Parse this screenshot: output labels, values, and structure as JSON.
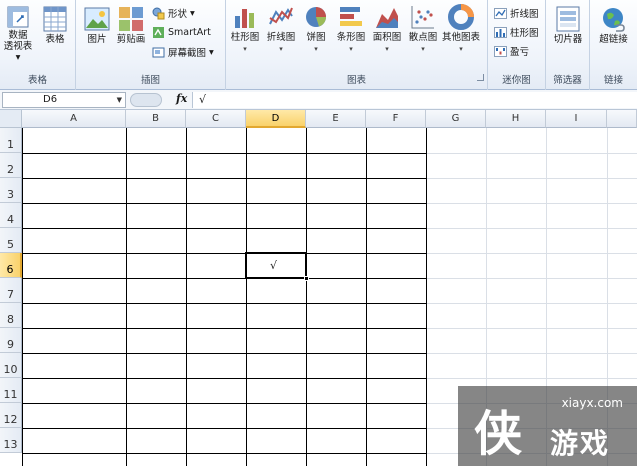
{
  "ribbon": {
    "tables_group": {
      "label": "表格",
      "pivot_line1": "数据",
      "pivot_line2": "透视表",
      "table": "表格"
    },
    "illustrations_group": {
      "label": "插图",
      "picture": "图片",
      "clipart": "剪贴画",
      "shapes": "形状",
      "smartart": "SmartArt",
      "screenshot": "屏幕截图"
    },
    "charts_group": {
      "label": "图表",
      "column": "柱形图",
      "line": "折线图",
      "pie": "饼图",
      "bar": "条形图",
      "area": "面积图",
      "scatter": "散点图",
      "other": "其他图表"
    },
    "sparklines_group": {
      "label": "迷你图",
      "line": "折线图",
      "column": "柱形图",
      "winloss": "盈亏"
    },
    "filter_group": {
      "label": "筛选器",
      "slicer": "切片器"
    },
    "links_group": {
      "label": "链接",
      "hyperlink": "超链接"
    }
  },
  "formula_bar": {
    "name_box": "D6",
    "fx_label": "fx",
    "content": "√"
  },
  "sheet": {
    "columns": [
      "A",
      "B",
      "C",
      "D",
      "E",
      "F",
      "G",
      "H",
      "I"
    ],
    "rows": [
      "1",
      "2",
      "3",
      "4",
      "5",
      "6",
      "7",
      "8",
      "9",
      "10",
      "11",
      "12",
      "13"
    ],
    "active_cell": "D6",
    "active_cell_value": "√",
    "bordered_range": "A1:F13"
  },
  "watermark": {
    "url": "xiayx.com",
    "big_char": "侠",
    "word": "游戏"
  },
  "colors": {
    "ribbon_bg": "#eef3fa",
    "header_active": "#f9d26b",
    "gridline": "#dadfe6"
  }
}
